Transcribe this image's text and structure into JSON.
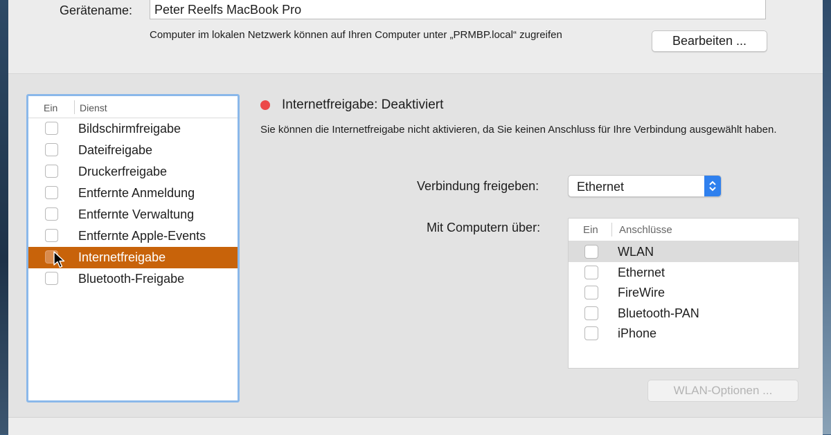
{
  "header": {
    "device_name_label": "Gerätename:",
    "device_name_value": "Peter Reelfs MacBook Pro",
    "info_text": "Computer im lokalen Netzwerk können auf Ihren Computer unter „PRMBP.local“ zugreifen",
    "edit_button": "Bearbeiten ..."
  },
  "services": {
    "col_on": "Ein",
    "col_service": "Dienst",
    "items": [
      {
        "label": "Bildschirmfreigabe",
        "checked": false
      },
      {
        "label": "Dateifreigabe",
        "checked": false
      },
      {
        "label": "Druckerfreigabe",
        "checked": false
      },
      {
        "label": "Entfernte Anmeldung",
        "checked": false
      },
      {
        "label": "Entfernte Verwaltung",
        "checked": false
      },
      {
        "label": "Entfernte Apple-Events",
        "checked": false
      },
      {
        "label": "Internetfreigabe",
        "checked": false,
        "selected": true
      },
      {
        "label": "Bluetooth-Freigabe",
        "checked": false
      }
    ]
  },
  "detail": {
    "status_title": "Internetfreigabe: Deaktiviert",
    "status_color": "#ec4848",
    "status_desc": "Sie können die Internetfreigabe nicht aktivieren, da Sie keinen Anschluss für Ihre Verbindung ausgewählt haben.",
    "share_label": "Verbindung freigeben:",
    "share_value": "Ethernet",
    "via_label": "Mit Computern über:",
    "ports_col_on": "Ein",
    "ports_col_name": "Anschlüsse",
    "ports": [
      {
        "label": "WLAN",
        "checked": false,
        "highlighted": true
      },
      {
        "label": "Ethernet",
        "checked": false
      },
      {
        "label": "FireWire",
        "checked": false
      },
      {
        "label": "Bluetooth-PAN",
        "checked": false
      },
      {
        "label": "iPhone",
        "checked": false
      }
    ],
    "wlan_options_button": "WLAN-Optionen ..."
  },
  "colors": {
    "selection": "#c8630a",
    "focus_ring": "#8ab8ea",
    "popup_accent": "#2f80ee"
  }
}
